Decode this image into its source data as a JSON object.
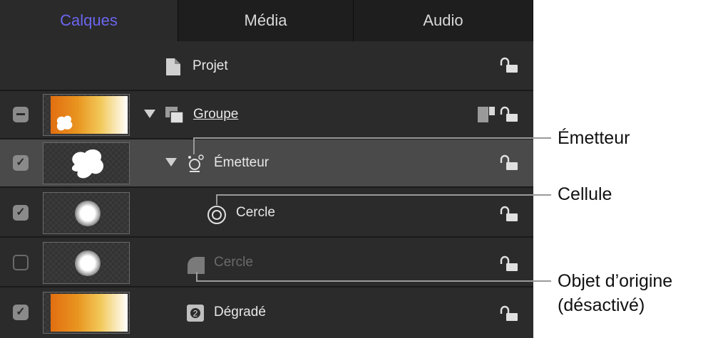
{
  "tabs": [
    {
      "label": "Calques",
      "active": true
    },
    {
      "label": "Média",
      "active": false
    },
    {
      "label": "Audio",
      "active": false
    }
  ],
  "rows": [
    {
      "name": "Projet",
      "icon": "document-icon",
      "checkbox": "none",
      "thumbnail": "none"
    },
    {
      "name": "Groupe",
      "icon": "group-icon",
      "checkbox": "mixed",
      "thumbnail": "gradient-with-blob",
      "expanded": true
    },
    {
      "name": "Émetteur",
      "icon": "emitter-icon",
      "checkbox": "checked",
      "thumbnail": "white-blob",
      "expanded": true,
      "selected": true
    },
    {
      "name": "Cercle",
      "icon": "cell-icon",
      "checkbox": "checked",
      "thumbnail": "white-glow"
    },
    {
      "name": "Cercle",
      "icon": "shape-icon",
      "checkbox": "unchecked",
      "thumbnail": "white-glow",
      "disabled": true
    },
    {
      "name": "Dégradé",
      "icon": "gradient-layer-icon",
      "checkbox": "checked",
      "thumbnail": "gradient"
    }
  ],
  "callouts": {
    "emitter": "Émetteur",
    "cell": "Cellule",
    "source_line1": "Objet d’origine",
    "source_line2": "(désactivé)"
  },
  "colors": {
    "accent_tab": "#6b66f0",
    "selected_row": "#4a4a4a",
    "panel": "#262626"
  }
}
